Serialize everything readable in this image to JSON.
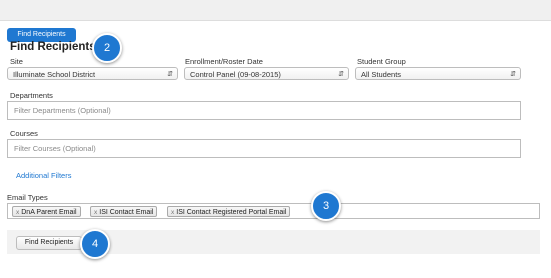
{
  "header": {
    "tab_button_label": "Find Recipients",
    "title": "Find Recipients"
  },
  "filters": {
    "site": {
      "label": "Site",
      "value": "Illuminate School District"
    },
    "enrollment": {
      "label": "Enrollment/Roster Date",
      "value": "Control Panel (09-08-2015)"
    },
    "student_group": {
      "label": "Student Group",
      "value": "All Students"
    },
    "departments": {
      "label": "Departments",
      "placeholder": "Filter Departments (Optional)"
    },
    "courses": {
      "label": "Courses",
      "placeholder": "Filter Courses (Optional)"
    },
    "additional_filters_label": "Additional Filters"
  },
  "email_types": {
    "label": "Email Types",
    "remove_glyph": "x",
    "tags": [
      "DnA Parent Email",
      "ISI Contact Email",
      "ISI Contact Registered Portal Email"
    ]
  },
  "footer": {
    "button_label": "Find Recipients"
  },
  "callouts": [
    "2",
    "3",
    "4"
  ],
  "icons": {
    "select_arrow": "updown-arrows-icon",
    "tag_remove": "close-icon"
  },
  "colors": {
    "accent": "#1f78d1",
    "footer_bg": "#f2f2f2"
  }
}
